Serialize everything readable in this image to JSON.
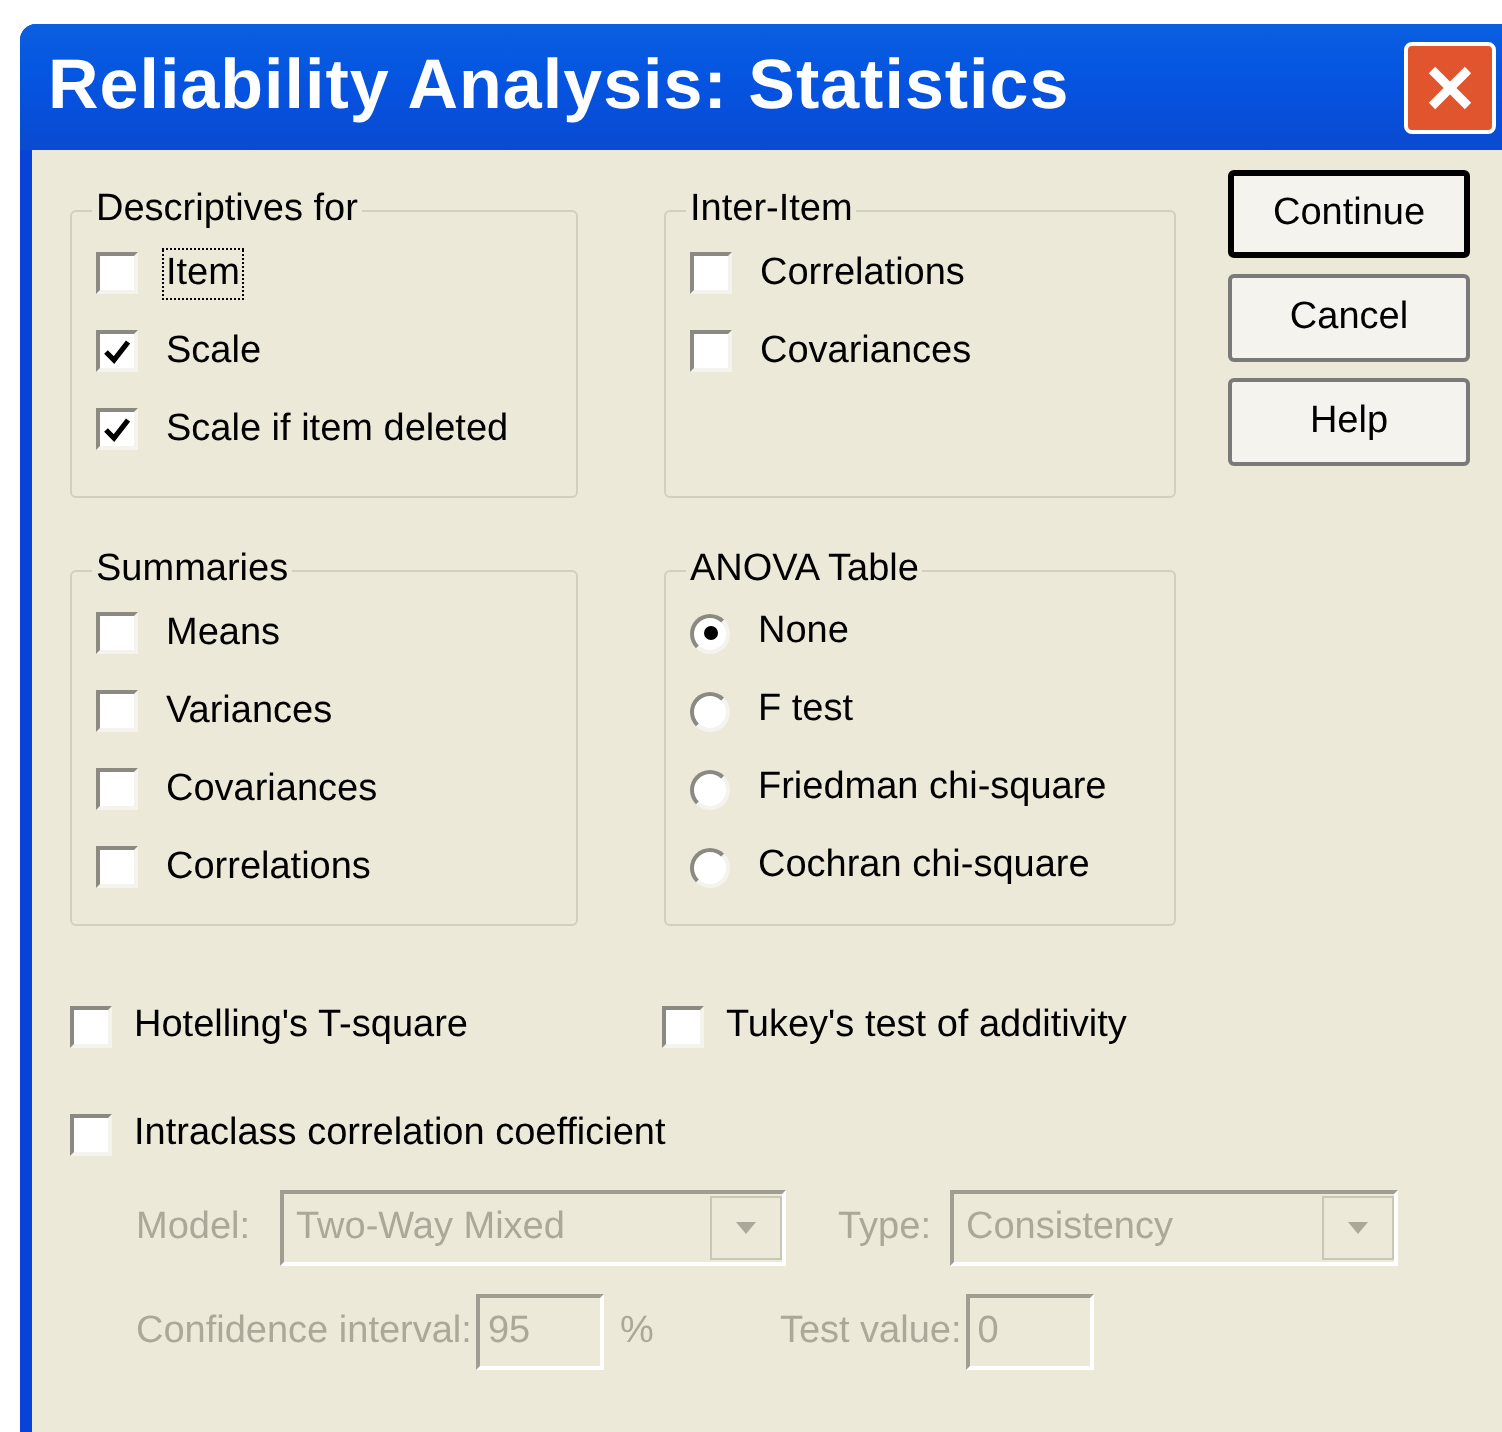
{
  "window": {
    "title": "Reliability Analysis: Statistics"
  },
  "descriptives": {
    "title": "Descriptives for",
    "items": [
      {
        "label": "Item",
        "checked": false,
        "focused": true
      },
      {
        "label": "Scale",
        "checked": true,
        "focused": false
      },
      {
        "label": "Scale if item deleted",
        "checked": true,
        "focused": false
      }
    ]
  },
  "inter_item": {
    "title": "Inter-Item",
    "items": [
      {
        "label": "Correlations",
        "checked": false
      },
      {
        "label": "Covariances",
        "checked": false
      }
    ]
  },
  "buttons": [
    {
      "label": "Continue",
      "default": true
    },
    {
      "label": "Cancel",
      "default": false
    },
    {
      "label": "Help",
      "default": false
    }
  ],
  "summaries": {
    "title": "Summaries",
    "items": [
      {
        "label": "Means",
        "checked": false
      },
      {
        "label": "Variances",
        "checked": false
      },
      {
        "label": "Covariances",
        "checked": false
      },
      {
        "label": "Correlations",
        "checked": false
      }
    ]
  },
  "anova_table": {
    "title": "ANOVA Table",
    "options": [
      {
        "label": "None",
        "selected": true
      },
      {
        "label": "F test",
        "selected": false
      },
      {
        "label": "Friedman chi-square",
        "selected": false
      },
      {
        "label": "Cochran chi-square",
        "selected": false
      }
    ]
  },
  "hotelling": {
    "label": "Hotelling's T-square",
    "checked": false
  },
  "tukey": {
    "label": "Tukey's test of additivity",
    "checked": false
  },
  "intraclass": {
    "label": "Intraclass correlation coefficient",
    "checked": false
  },
  "icc_options": {
    "disabled": true,
    "model": {
      "label": "Model:",
      "value": "Two-Way Mixed"
    },
    "type": {
      "label": "Type:",
      "value": "Consistency"
    },
    "confidence_interval": {
      "label": "Confidence interval:",
      "value": "95",
      "unit": "%"
    },
    "test_value": {
      "label": "Test value:",
      "value": "0"
    }
  }
}
